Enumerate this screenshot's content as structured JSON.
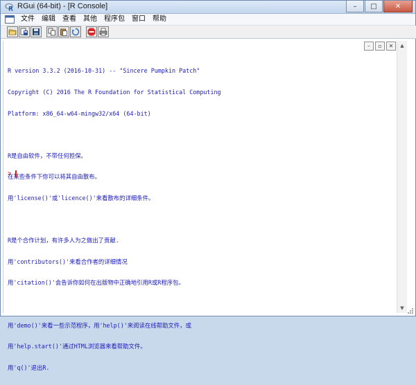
{
  "window": {
    "title": "RGui (64-bit) - [R Console]",
    "controls": {
      "minimize": "–",
      "maximize": "□",
      "close": "✕"
    }
  },
  "menubar": {
    "items": [
      "文件",
      "编辑",
      "查看",
      "其他",
      "程序包",
      "窗口",
      "帮助"
    ]
  },
  "toolbar": {
    "buttons": [
      {
        "name": "open-script-icon"
      },
      {
        "name": "load-workspace-icon"
      },
      {
        "name": "save-workspace-icon"
      },
      {
        "name": "copy-icon"
      },
      {
        "name": "paste-icon"
      },
      {
        "name": "copy-paste-icon"
      },
      {
        "name": "stop-icon"
      },
      {
        "name": "print-icon"
      }
    ]
  },
  "mdi": {
    "controls": {
      "minimize": "–",
      "restore": "▫",
      "close": "✕"
    }
  },
  "console": {
    "lines": [
      "R version 3.3.2 (2016-10-31) -- \"Sincere Pumpkin Patch\"",
      "Copyright (C) 2016 The R Foundation for Statistical Computing",
      "Platform: x86_64-w64-mingw32/x64 (64-bit)",
      "",
      "R是自由软件，不带任何担保。",
      "在某些条件下你可以将其自由散布。",
      "用'license()'或'licence()'来看散布的详细条件。",
      "",
      "R是个合作计划，有许多人为之做出了贡献.",
      "用'contributors()'来看合作者的详细情况",
      "用'citation()'会告诉你如何在出版物中正确地引用R或R程序包。",
      "",
      "用'demo()'来看一些示范程序，用'help()'来阅读在线帮助文件，或",
      "用'help.start()'通过HTML浏览器来看帮助文件。",
      "用'q()'退出R."
    ],
    "prompt": ">"
  },
  "colors": {
    "output_text": "#1b1bb8",
    "prompt": "#d11a1a"
  }
}
